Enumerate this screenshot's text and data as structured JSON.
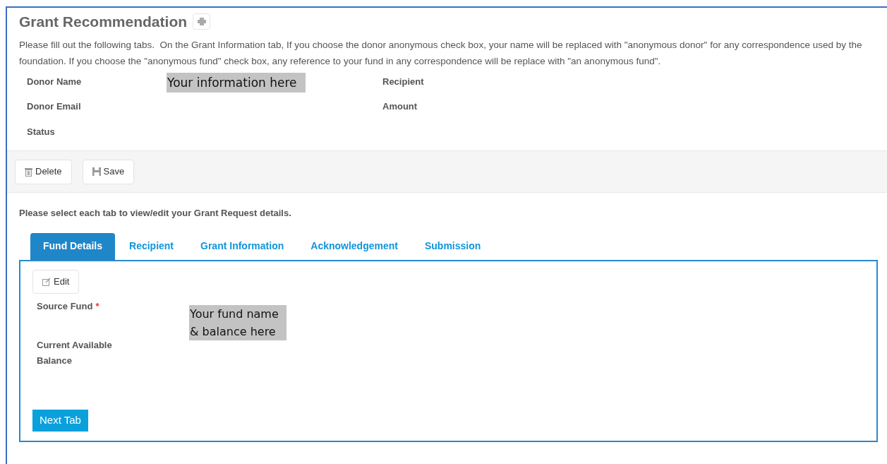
{
  "title": "Grant Recommendation",
  "intro": "Please fill out the following tabs.  On the Grant Information tab, If you choose the donor anonymous check box, your name will be replaced with \"anonymous donor\" for any correspondence used by the foundation. If you choose the \"anonymous fund\" check box, any reference to your fund in any correspondence will be replace with \"an anonymous fund\".",
  "summary_left": [
    "Donor Name",
    "Donor Email",
    "Status"
  ],
  "summary_right": [
    "Recipient",
    "Amount"
  ],
  "summary_note": "Your information here",
  "toolbar": [
    {
      "label": "Delete",
      "kind": "trash"
    },
    {
      "label": "Save",
      "kind": "save"
    }
  ],
  "tabs_hint": "Please select each tab to view/edit your Grant Request details.",
  "tabs": [
    {
      "label": "Fund Details",
      "selected": true
    },
    {
      "label": "Recipient",
      "selected": false
    },
    {
      "label": "Grant Information",
      "selected": false
    },
    {
      "label": "Acknowledgement",
      "selected": false
    },
    {
      "label": "Submission",
      "selected": false
    }
  ],
  "panel": {
    "edit_button": "Edit",
    "fields": [
      {
        "label": "Source Fund",
        "required_mark": "*"
      },
      {
        "label": "Current Available Balance"
      }
    ],
    "note": "Your fund name & balance here",
    "next_button": "Next Tab"
  }
}
